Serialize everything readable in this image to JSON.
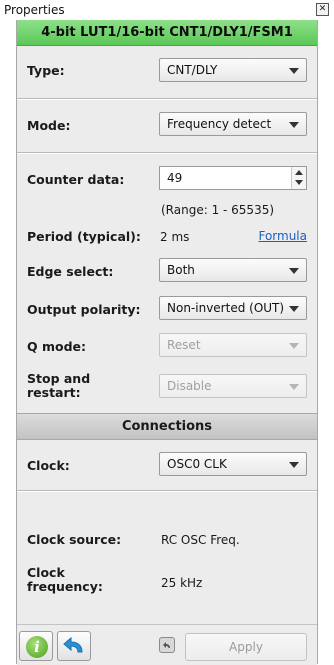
{
  "window": {
    "title": "Properties",
    "close_glyph": "✕"
  },
  "header": {
    "title": "4-bit LUT1/16-bit CNT1/DLY1/FSM1"
  },
  "fields": {
    "type": {
      "label": "Type:",
      "value": "CNT/DLY"
    },
    "mode": {
      "label": "Mode:",
      "value": "Frequency detect"
    },
    "counter_data": {
      "label": "Counter data:",
      "value": "49",
      "range": "(Range:  1 - 65535)"
    },
    "period": {
      "label": "Period (typical):",
      "value": "2 ms",
      "link": "Formula"
    },
    "edge_select": {
      "label": "Edge select:",
      "value": "Both"
    },
    "output_polarity": {
      "label": "Output polarity:",
      "value": "Non-inverted (OUT)"
    },
    "q_mode": {
      "label": "Q mode:",
      "value": "Reset",
      "disabled": true
    },
    "stop_restart": {
      "label_line1": "Stop and",
      "label_line2": "restart:",
      "value": "Disable",
      "disabled": true
    }
  },
  "connections": {
    "title": "Connections",
    "clock": {
      "label": "Clock:",
      "value": "OSC0 CLK"
    },
    "clock_source": {
      "label": "Clock source:",
      "value": "RC OSC Freq."
    },
    "clock_frequency": {
      "label_line1": "Clock",
      "label_line2": "frequency:",
      "value": "25 kHz"
    }
  },
  "bottom": {
    "apply_label": "Apply",
    "info_glyph": "i"
  },
  "icons": [
    "close-icon",
    "info-icon",
    "undo-icon",
    "small-undo-icon",
    "spin-up-icon",
    "spin-down-icon",
    "dropdown-arrow-icon"
  ],
  "colors": {
    "header_green": "#5bc856",
    "link_blue": "#1f5fbf",
    "panel_bg": "#ececec"
  }
}
